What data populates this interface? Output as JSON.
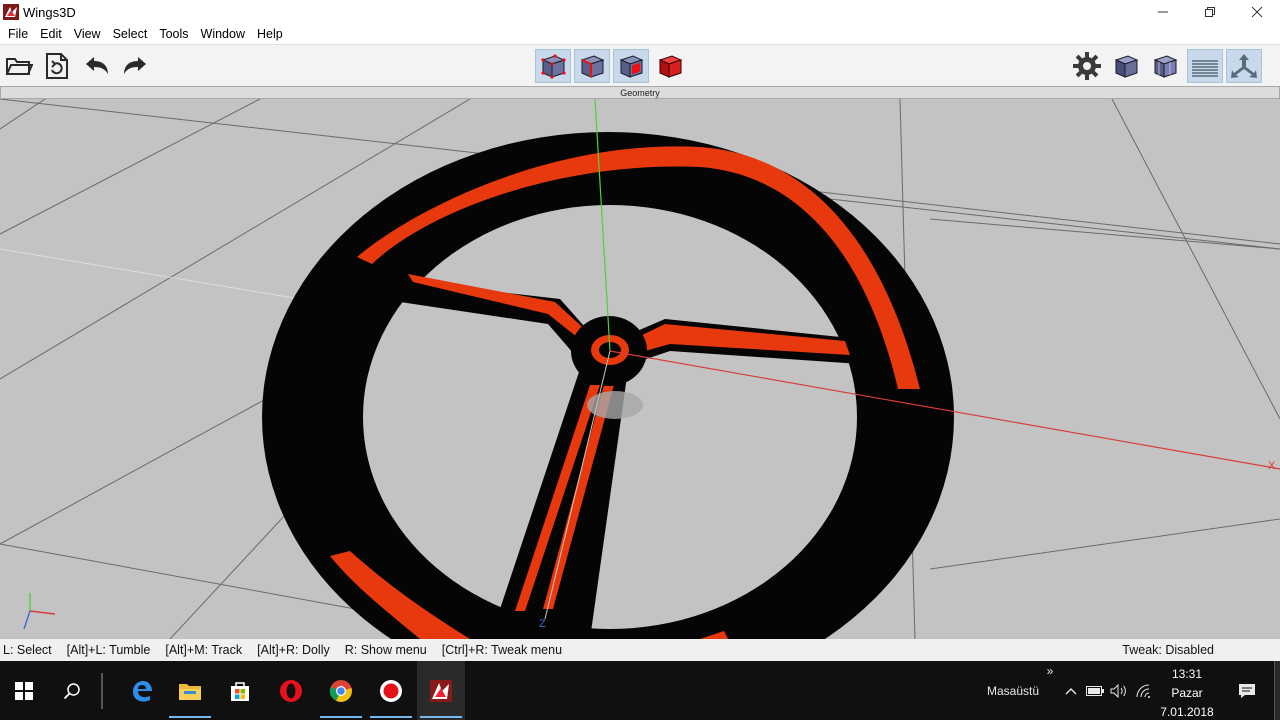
{
  "window": {
    "title": "Wings3D",
    "minimize_icon": "minimize-icon",
    "maximize_icon": "restore-icon",
    "close_icon": "close-icon"
  },
  "menu": {
    "items": [
      "File",
      "Edit",
      "View",
      "Select",
      "Tools",
      "Window",
      "Help"
    ]
  },
  "toolbar": {
    "left_icons": [
      "open-folder-icon",
      "save-icon",
      "undo-icon",
      "redo-icon"
    ],
    "select_modes": [
      "vertex-mode-icon",
      "edge-mode-icon",
      "face-mode-icon",
      "body-mode-icon"
    ],
    "right_icons": [
      "gear-icon",
      "smooth-shaded-icon",
      "wireframe-cube-icon",
      "groundplane-icon",
      "axes-icon"
    ]
  },
  "geometry": {
    "header": "Geometry",
    "axis_x_label": "X",
    "axis_z_label": "Z",
    "colors": {
      "background": "#c3c3c3",
      "wheel": "#050505",
      "accent": "#e8380e",
      "x_axis": "#d93b3b",
      "y_axis": "#4fd13a",
      "grid": "#555555"
    }
  },
  "statusbar": {
    "hints": [
      "L: Select",
      "[Alt]+L: Tumble",
      "[Alt]+M: Track",
      "[Alt]+R: Dolly",
      "R: Show menu",
      "[Ctrl]+R: Tweak menu"
    ],
    "tweak": "Tweak: Disabled"
  },
  "taskbar": {
    "apps": [
      "start-icon",
      "search-icon",
      "edge-icon",
      "file-explorer-icon",
      "store-icon",
      "opera-icon",
      "chrome-icon",
      "record-icon",
      "wings3d-icon"
    ],
    "desktop_label": "Masaüstü",
    "overflow": "»",
    "time": "13:31",
    "day": "Pazar",
    "date": "7.01.2018"
  }
}
